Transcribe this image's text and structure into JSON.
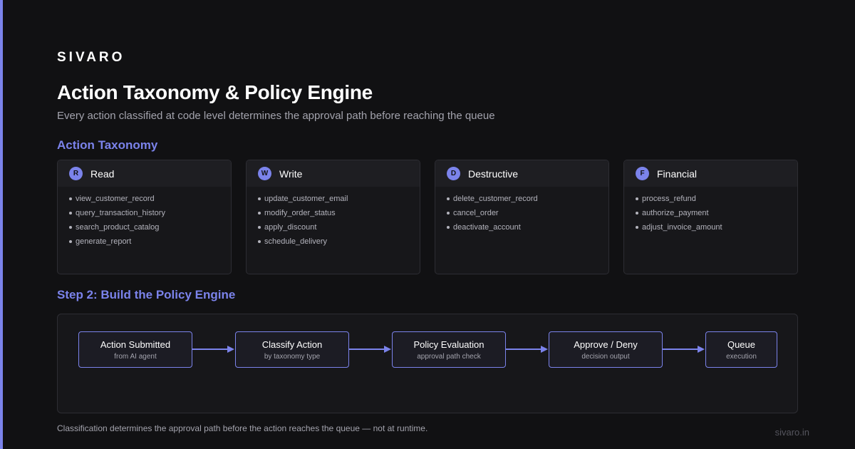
{
  "brand": "SIVARO",
  "title": "Action Taxonomy & Policy Engine",
  "subtitle": "Every action classified at code level determines the approval path before reaching the queue",
  "colors": {
    "accent": "#7b83eb",
    "background": "#111113",
    "card": "#17171a"
  },
  "taxonomy": {
    "heading": "Action Taxonomy",
    "categories": [
      {
        "badge": "R",
        "name": "Read",
        "actions": [
          "view_customer_record",
          "query_transaction_history",
          "search_product_catalog",
          "generate_report"
        ]
      },
      {
        "badge": "W",
        "name": "Write",
        "actions": [
          "update_customer_email",
          "modify_order_status",
          "apply_discount",
          "schedule_delivery"
        ]
      },
      {
        "badge": "D",
        "name": "Destructive",
        "actions": [
          "delete_customer_record",
          "cancel_order",
          "deactivate_account"
        ]
      },
      {
        "badge": "F",
        "name": "Financial",
        "actions": [
          "process_refund",
          "authorize_payment",
          "adjust_invoice_amount"
        ]
      }
    ]
  },
  "policy": {
    "heading": "Step 2: Build the Policy Engine",
    "steps": [
      {
        "title": "Action Submitted",
        "subtitle": "from AI agent"
      },
      {
        "title": "Classify Action",
        "subtitle": "by taxonomy type"
      },
      {
        "title": "Policy Evaluation",
        "subtitle": "approval path check"
      },
      {
        "title": "Approve / Deny",
        "subtitle": "decision output"
      },
      {
        "title": "Queue",
        "subtitle": "execution"
      }
    ]
  },
  "footnote": "Classification determines the approval path before the action reaches the queue — not at runtime.",
  "site": "sivaro.in"
}
